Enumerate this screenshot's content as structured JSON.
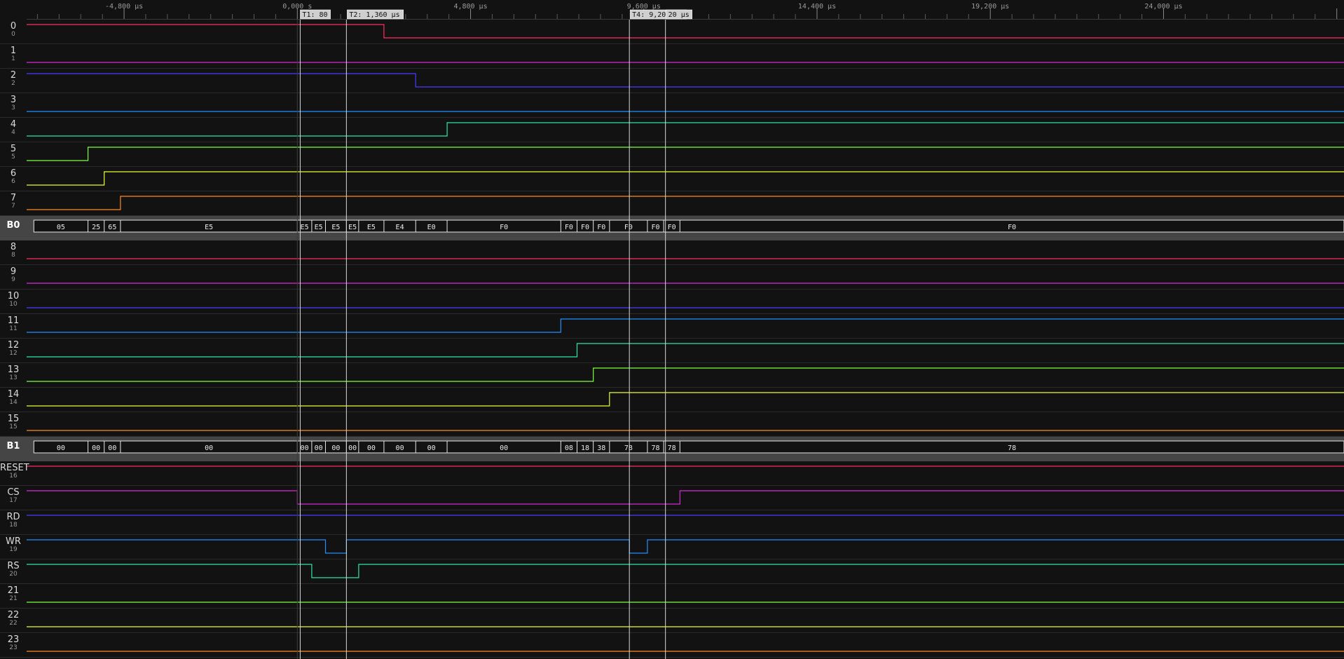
{
  "ruler": {
    "labels": [
      "-4,800 µs",
      "0,000 s",
      "4,800 µs",
      "9,600 µs",
      "14,400 µs",
      "19,200 µs",
      "24,000 µs"
    ]
  },
  "cursors": [
    {
      "id": "T1",
      "label": "T1: 80",
      "t_us": 80,
      "interactable": true
    },
    {
      "id": "T2",
      "label": "T2: 1,360 µs",
      "t_us": 1360,
      "interactable": true
    },
    {
      "id": "T3",
      "label": "",
      "t_us": 9200,
      "interactable": true
    },
    {
      "id": "T4",
      "label": "T4: 9,200 µs",
      "t_us": 10200,
      "interactable": true
    },
    {
      "id": "T5",
      "label": "20 µs",
      "t_us": null,
      "interactable": false
    }
  ],
  "channels": [
    {
      "name": "0",
      "index": "0",
      "color": "#ff2e63"
    },
    {
      "name": "1",
      "index": "1",
      "color": "#d62ad6"
    },
    {
      "name": "2",
      "index": "2",
      "color": "#4a3cff"
    },
    {
      "name": "3",
      "index": "3",
      "color": "#1e90ff"
    },
    {
      "name": "4",
      "index": "4",
      "color": "#2ee6a8"
    },
    {
      "name": "5",
      "index": "5",
      "color": "#7dff3c"
    },
    {
      "name": "6",
      "index": "6",
      "color": "#e8ff2e"
    },
    {
      "name": "7",
      "index": "7",
      "color": "#ff8a1e"
    },
    {
      "name": "B0",
      "bus": true
    },
    {
      "name": "8",
      "index": "8",
      "color": "#ff2e63"
    },
    {
      "name": "9",
      "index": "9",
      "color": "#d62ad6"
    },
    {
      "name": "10",
      "index": "10",
      "color": "#4a3cff"
    },
    {
      "name": "11",
      "index": "11",
      "color": "#1e90ff"
    },
    {
      "name": "12",
      "index": "12",
      "color": "#2ee6a8"
    },
    {
      "name": "13",
      "index": "13",
      "color": "#7dff3c"
    },
    {
      "name": "14",
      "index": "14",
      "color": "#e8ff2e"
    },
    {
      "name": "15",
      "index": "15",
      "color": "#ff8a1e"
    },
    {
      "name": "B1",
      "bus": true
    },
    {
      "name": "RESET",
      "index": "16",
      "color": "#ff2e63"
    },
    {
      "name": "CS",
      "index": "17",
      "color": "#d62ad6"
    },
    {
      "name": "RD",
      "index": "18",
      "color": "#4a3cff"
    },
    {
      "name": "WR",
      "index": "19",
      "color": "#1e90ff"
    },
    {
      "name": "RS",
      "index": "20",
      "color": "#2ee6a8"
    },
    {
      "name": "21",
      "index": "21",
      "color": "#7dff3c"
    },
    {
      "name": "22",
      "index": "22",
      "color": "#e8ff2e"
    },
    {
      "name": "23",
      "index": "23",
      "color": "#ff8a1e"
    }
  ],
  "timing": {
    "t_start_us": -7500,
    "t_end_us": 29000,
    "ruler_step_us": 4800,
    "ruler_minor_divisions": 8
  },
  "traces": {
    "0": {
      "init": 1,
      "edges_us": [
        2400
      ]
    },
    "1": {
      "init": 0,
      "edges_us": []
    },
    "2": {
      "init": 1,
      "edges_us": [
        3280
      ]
    },
    "3": {
      "init": 0,
      "edges_us": []
    },
    "4": {
      "init": 0,
      "edges_us": [
        4150
      ]
    },
    "5": {
      "init": 0,
      "edges_us": [
        -5800
      ]
    },
    "6": {
      "init": 0,
      "edges_us": [
        -5350
      ]
    },
    "7": {
      "init": 0,
      "edges_us": [
        -4900
      ]
    },
    "8": {
      "init": 0,
      "edges_us": []
    },
    "9": {
      "init": 0,
      "edges_us": []
    },
    "10": {
      "init": 0,
      "edges_us": []
    },
    "11": {
      "init": 0,
      "edges_us": [
        7300
      ]
    },
    "12": {
      "init": 0,
      "edges_us": [
        7750
      ]
    },
    "13": {
      "init": 0,
      "edges_us": [
        8200
      ]
    },
    "14": {
      "init": 0,
      "edges_us": [
        8650
      ]
    },
    "15": {
      "init": 0,
      "edges_us": []
    },
    "RESET": {
      "init": 1,
      "edges_us": []
    },
    "CS": {
      "init": 1,
      "edges_us": [
        0,
        10600
      ]
    },
    "RD": {
      "init": 1,
      "edges_us": []
    },
    "WR": {
      "init": 1,
      "edges_us": [
        780,
        1360,
        9200,
        9700
      ]
    },
    "RS": {
      "init": 1,
      "edges_us": [
        400,
        1700
      ]
    },
    "21": {
      "init": 0,
      "edges_us": []
    },
    "22": {
      "init": 0,
      "edges_us": []
    },
    "23": {
      "init": 0,
      "edges_us": []
    }
  },
  "bus_B0": {
    "values": [
      "05",
      "25",
      "65",
      "E5",
      "E5",
      "E5",
      "E5",
      "E5",
      "E5",
      "E4",
      "E0",
      "F0",
      "F0",
      "F0",
      "F0",
      "F0",
      "F0",
      "F0",
      "F0"
    ],
    "bounds_us": [
      -7300,
      -5800,
      -5350,
      -4900,
      0,
      400,
      780,
      1360,
      1700,
      2400,
      3280,
      4150,
      7300,
      7750,
      8200,
      8650,
      9700,
      10150,
      10600,
      29000
    ]
  },
  "bus_B1": {
    "values": [
      "00",
      "00",
      "00",
      "00",
      "00",
      "00",
      "00",
      "00",
      "00",
      "00",
      "00",
      "00",
      "08",
      "18",
      "38",
      "78",
      "78",
      "78",
      "78"
    ],
    "bounds_us": [
      -7300,
      -5800,
      -5350,
      -4900,
      0,
      400,
      780,
      1360,
      1700,
      2400,
      3280,
      4150,
      7300,
      7750,
      8200,
      8650,
      9700,
      10150,
      10600,
      29000
    ]
  }
}
